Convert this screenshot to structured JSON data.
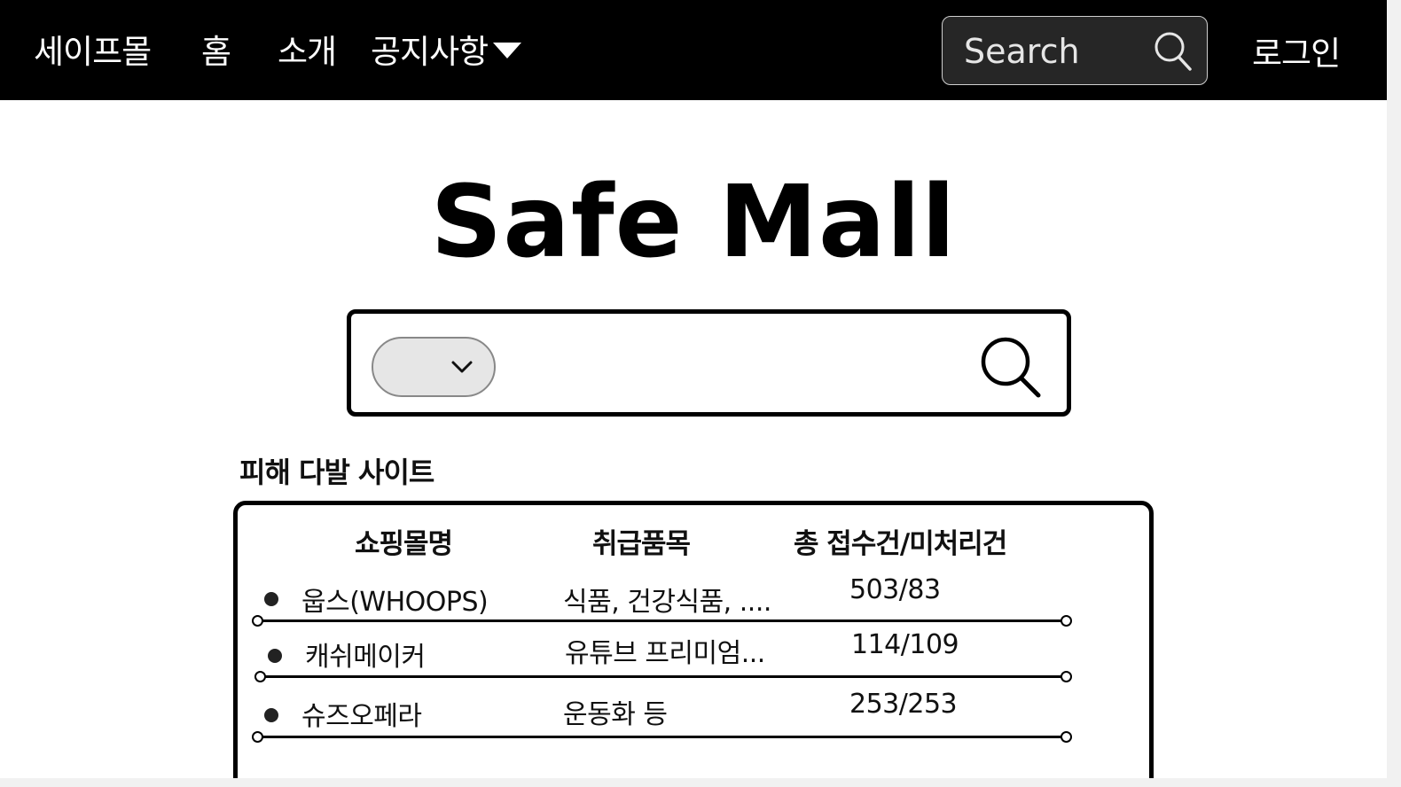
{
  "nav": {
    "brand": "세이프몰",
    "home": "홈",
    "about": "소개",
    "notice": "공지사항",
    "search_placeholder": "Search",
    "login": "로그인"
  },
  "hero": {
    "title": "Safe Mall",
    "search_value": ""
  },
  "section": {
    "title": "피해 다발 사이트"
  },
  "table": {
    "headers": [
      "쇼핑몰명",
      "취급품목",
      "총 접수건/미처리건"
    ],
    "rows": [
      {
        "name": "웁스(WHOOPS)",
        "items": "식품, 건강식품, ....",
        "count": "503/83"
      },
      {
        "name": "캐쉬메이커",
        "items": "유튜브 프리미엄...",
        "count": "114/109"
      },
      {
        "name": "슈즈오페라",
        "items": "운동화 등",
        "count": "253/253"
      }
    ]
  },
  "icons": {
    "nav_search": "search-icon",
    "dropdown": "caret-down-icon",
    "select": "chevron-down-icon",
    "main_search": "search-icon"
  },
  "colors": {
    "navbar": "#000000",
    "nav_search_bg": "#262626",
    "select_bg": "#e6e6e6"
  }
}
